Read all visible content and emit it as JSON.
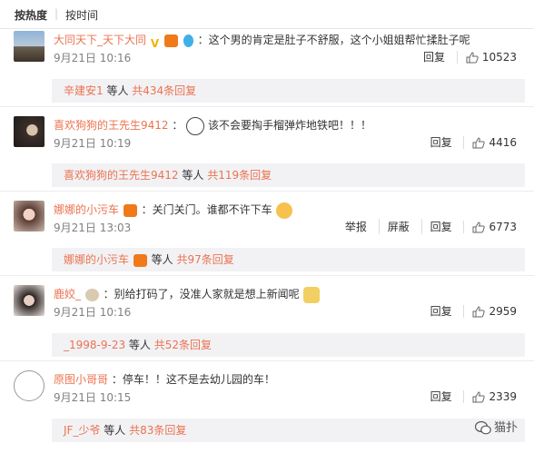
{
  "sort": {
    "hot": "按热度",
    "sep": "|",
    "time": "按时间"
  },
  "comments": [
    {
      "user": "大同天下_天下大同",
      "text": "：这个男的肯定是肚子不舒服，这个小姐姐帮忙揉肚子呢",
      "time": "9月21日 10:16",
      "reply_label": "回复",
      "likes": "10523",
      "replier": "辛建安1",
      "replies_mid": " 等人 ",
      "replies_count": "共434条回复"
    },
    {
      "user": "喜欢狗狗的王先生9412",
      "text": "：",
      "text2": "该不会要掏手榴弹炸地铁吧！！！",
      "time": "9月21日 10:19",
      "reply_label": "回复",
      "likes": "4416",
      "replier": "喜欢狗狗的王先生9412",
      "replies_mid": " 等人 ",
      "replies_count": "共119条回复"
    },
    {
      "user": "娜娜的小污车",
      "text": "：关门关门。谁都不许下车",
      "time": "9月21日 13:03",
      "report_label": "举报",
      "block_label": "屏蔽",
      "reply_label": "回复",
      "likes": "6773",
      "replier": "娜娜的小污车",
      "replies_mid": " 等人 ",
      "replies_count": "共97条回复"
    },
    {
      "user": "鹿姣_",
      "text": "：别给打码了，没准人家就是想上新闻呢",
      "time": "9月21日 10:16",
      "reply_label": "回复",
      "likes": "2959",
      "replier": "_1998-9-23",
      "replies_mid": " 等人 ",
      "replies_count": "共52条回复"
    },
    {
      "user": "原图小哥哥",
      "text": "：停车！！这不是去幼儿园的车！",
      "time": "9月21日 10:15",
      "reply_label": "回复",
      "likes": "2339",
      "replier": "JF_少爷",
      "replies_mid": " 等人 ",
      "replies_count": "共83条回复"
    }
  ],
  "watermark": "猫扑",
  "colors": {
    "username": "#eb7350",
    "reply_bg": "#f2f2f5",
    "text": "#333333",
    "time": "#808080"
  }
}
